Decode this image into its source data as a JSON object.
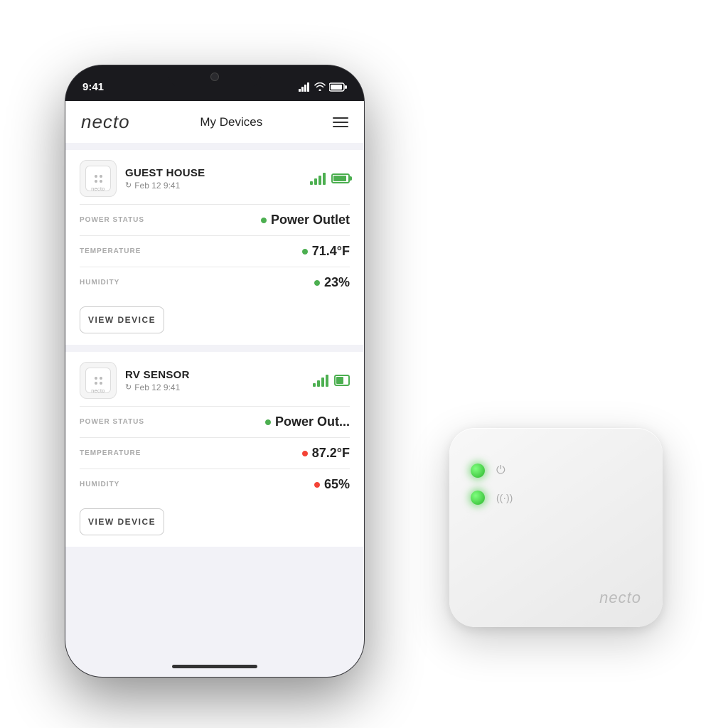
{
  "app": {
    "logo": "necto",
    "title": "My Devices",
    "hamburger_label": "menu"
  },
  "status_bar": {
    "time": "9:41",
    "signal_label": "signal",
    "wifi_label": "wifi",
    "battery_label": "battery"
  },
  "devices": [
    {
      "id": "guest-house",
      "name": "GUEST HOUSE",
      "sync_time": "Feb 12 9:41",
      "signal": "full",
      "battery": "full",
      "status_dot": "green",
      "power_status_label": "POWER STATUS",
      "power_status_value": "Power Outlet",
      "temperature_label": "TEMPERATURE",
      "temperature_value": "71.4°F",
      "temperature_dot": "green",
      "humidity_label": "HUMIDITY",
      "humidity_value": "23%",
      "humidity_dot": "green",
      "view_button_label": "VIEW DEVICE"
    },
    {
      "id": "rv-sensor",
      "name": "RV SENSOR",
      "sync_time": "Feb 12 9:41",
      "signal": "full",
      "battery": "partial",
      "status_dot": "green",
      "power_status_label": "POWER STATUS",
      "power_status_value": "Power Out...",
      "temperature_label": "TEMPERATURE",
      "temperature_value": "87.2°F",
      "temperature_dot": "red",
      "humidity_label": "HUMIDITY",
      "humidity_value": "65%",
      "humidity_dot": "red",
      "view_button_label": "VIEW DEVICE"
    }
  ],
  "necto_device": {
    "brand": "necto",
    "led1_label": "power-led",
    "led2_label": "wifi-led",
    "power_icon": "⏻",
    "wifi_icon": "((·))"
  }
}
